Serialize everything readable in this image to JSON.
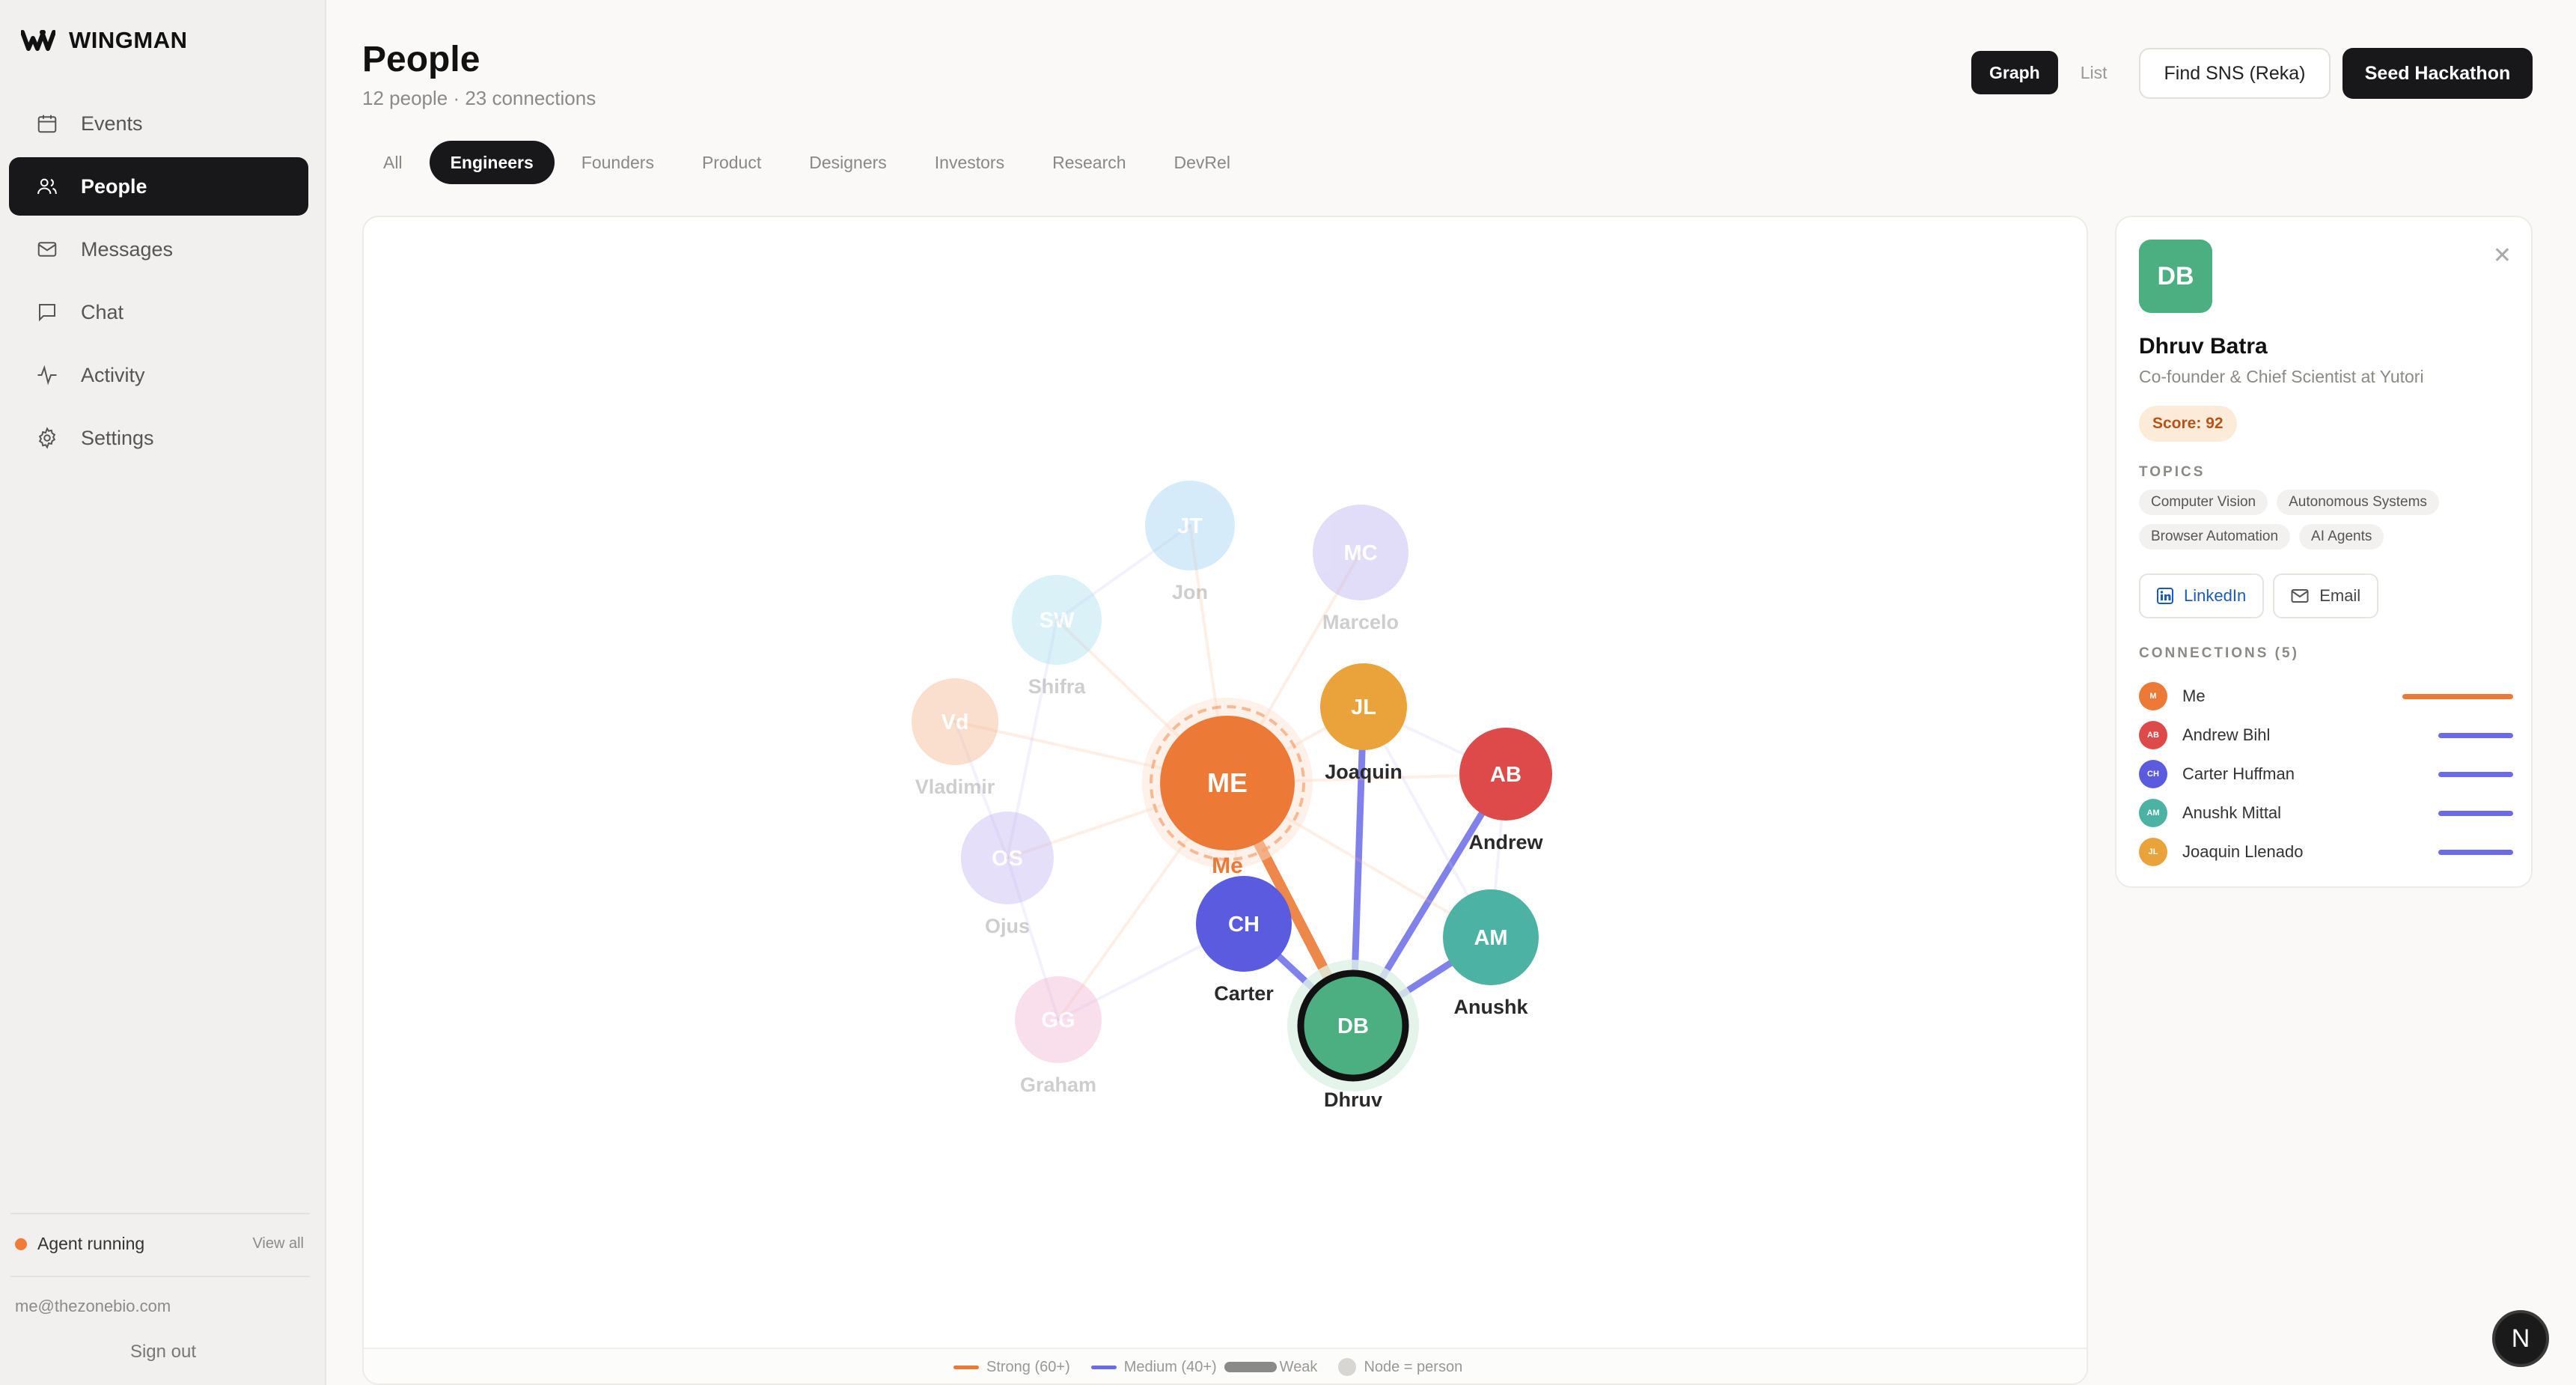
{
  "app": {
    "brand": "WINGMAN",
    "nav": [
      {
        "label": "Events",
        "icon": "calendar-icon"
      },
      {
        "label": "People",
        "icon": "people-icon",
        "active": true
      },
      {
        "label": "Messages",
        "icon": "mail-icon"
      },
      {
        "label": "Chat",
        "icon": "chat-icon"
      },
      {
        "label": "Activity",
        "icon": "activity-icon"
      },
      {
        "label": "Settings",
        "icon": "gear-icon"
      }
    ],
    "agent_status": "Agent running",
    "view_all": "View all",
    "user_email": "me@thezonebio.com",
    "sign_out": "Sign out"
  },
  "header": {
    "title": "People",
    "subtitle": "12 people · 23 connections",
    "view_graph": "Graph",
    "view_list": "List",
    "find_button": "Find SNS (Reka)",
    "seed_button": "Seed Hackathon"
  },
  "filters": [
    "All",
    "Engineers",
    "Founders",
    "Product",
    "Designers",
    "Investors",
    "Research",
    "DevRel"
  ],
  "active_filter": "Engineers",
  "graph": {
    "nodes": [
      {
        "id": "JT",
        "label": "Jon",
        "color": "#9fd0f2",
        "faded": true
      },
      {
        "id": "MC",
        "label": "Marcelo",
        "color": "#b9b0f0",
        "faded": true
      },
      {
        "id": "SW",
        "label": "Shifra",
        "color": "#a9def0",
        "faded": true
      },
      {
        "id": "Vd",
        "label": "Vladimir",
        "color": "#f5b58f",
        "faded": true
      },
      {
        "id": "OS",
        "label": "Ojus",
        "color": "#c2b4f2",
        "faded": true
      },
      {
        "id": "GG",
        "label": "Graham",
        "color": "#f2b4d4",
        "faded": true
      },
      {
        "id": "ME",
        "label": "Me",
        "color": "#ec7a36",
        "faded": false
      },
      {
        "id": "JL",
        "label": "Joaquin",
        "color": "#eaa33a",
        "faded": false
      },
      {
        "id": "AB",
        "label": "Andrew",
        "color": "#de4a4a",
        "faded": false
      },
      {
        "id": "CH",
        "label": "Carter",
        "color": "#5b5be0",
        "faded": false
      },
      {
        "id": "AM",
        "label": "Anushk",
        "color": "#4bb2a4",
        "faded": false
      },
      {
        "id": "DB",
        "label": "Dhruv",
        "color": "#4caf82",
        "faded": false,
        "selected": true
      }
    ],
    "edges": [
      {
        "from": "ME",
        "to": "DB",
        "strength": "strong"
      },
      {
        "from": "JL",
        "to": "DB",
        "strength": "medium"
      },
      {
        "from": "AB",
        "to": "DB",
        "strength": "medium"
      },
      {
        "from": "CH",
        "to": "DB",
        "strength": "medium"
      },
      {
        "from": "AM",
        "to": "DB",
        "strength": "medium"
      },
      {
        "from": "ME",
        "to": "JT",
        "strength": "faint"
      },
      {
        "from": "ME",
        "to": "MC",
        "strength": "faint"
      },
      {
        "from": "ME",
        "to": "SW",
        "strength": "faint"
      },
      {
        "from": "ME",
        "to": "Vd",
        "strength": "faint"
      },
      {
        "from": "ME",
        "to": "OS",
        "strength": "faint"
      },
      {
        "from": "ME",
        "to": "GG",
        "strength": "faint"
      },
      {
        "from": "ME",
        "to": "AB",
        "strength": "faint"
      },
      {
        "from": "ME",
        "to": "AM",
        "strength": "faint"
      },
      {
        "from": "ME",
        "to": "CH",
        "strength": "faint"
      },
      {
        "from": "ME",
        "to": "JL",
        "strength": "faint"
      },
      {
        "from": "SW",
        "to": "OS",
        "strength": "faint"
      },
      {
        "from": "SW",
        "to": "JT",
        "strength": "faint"
      },
      {
        "from": "JL",
        "to": "AB",
        "strength": "faint"
      },
      {
        "from": "JL",
        "to": "AM",
        "strength": "faint"
      },
      {
        "from": "CH",
        "to": "GG",
        "strength": "faint"
      },
      {
        "from": "AB",
        "to": "AM",
        "strength": "faint"
      },
      {
        "from": "OS",
        "to": "GG",
        "strength": "faint"
      },
      {
        "from": "Vd",
        "to": "OS",
        "strength": "faint"
      }
    ],
    "legend": {
      "strong": "Strong (60+)",
      "medium": "Medium (40+)",
      "weak": "Weak",
      "node": "Node = person",
      "strong_color": "#ec7a36",
      "medium_color": "#6b6be8",
      "weak_color": "#8a8a8a"
    }
  },
  "detail": {
    "initials": "DB",
    "name": "Dhruv Batra",
    "role": "Co-founder & Chief Scientist at Yutori",
    "score": "Score: 92",
    "topics_label": "TOPICS",
    "topics": [
      "Computer Vision",
      "Autonomous Systems",
      "Browser Automation",
      "AI Agents"
    ],
    "linkedin": "LinkedIn",
    "email": "Email",
    "connections_label": "CONNECTIONS (5)",
    "connections": [
      {
        "initials": "M",
        "name": "Me",
        "color": "#ec7a36",
        "bar_color": "#ec7a36",
        "strength": "strong"
      },
      {
        "initials": "AB",
        "name": "Andrew Bihl",
        "color": "#de4a4a",
        "bar_color": "#6b6be8",
        "strength": "medium"
      },
      {
        "initials": "CH",
        "name": "Carter Huffman",
        "color": "#5b5be0",
        "bar_color": "#6b6be8",
        "strength": "medium"
      },
      {
        "initials": "AM",
        "name": "Anushk Mittal",
        "color": "#4bb2a4",
        "bar_color": "#6b6be8",
        "strength": "medium"
      },
      {
        "initials": "JL",
        "name": "Joaquin Llenado",
        "color": "#eaa33a",
        "bar_color": "#6b6be8",
        "strength": "medium"
      }
    ]
  },
  "badge": "N"
}
